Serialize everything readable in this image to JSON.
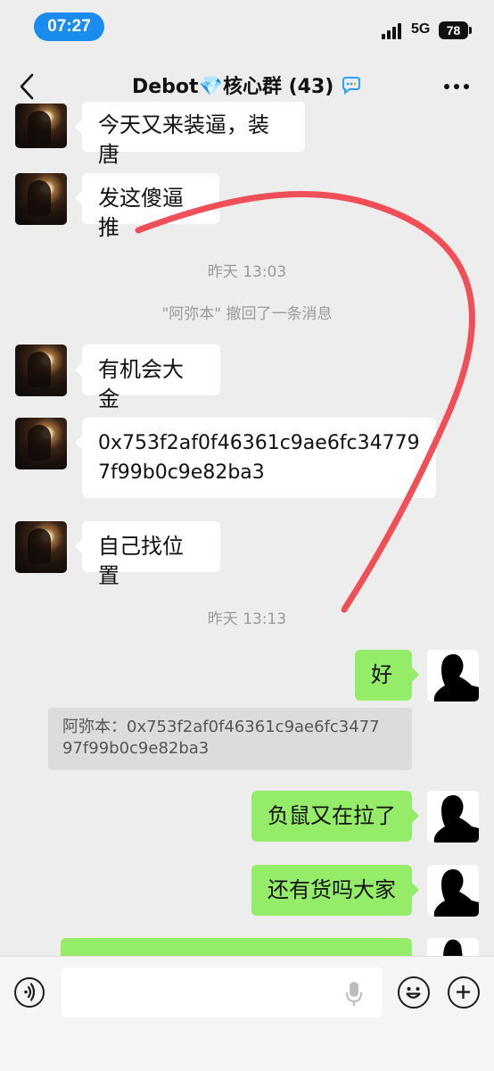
{
  "status_bar": {
    "time": "07:27",
    "network": "5G",
    "battery": "78"
  },
  "nav": {
    "title": "Debot",
    "title_gem": "💎",
    "title_rest": "核心群 (43)",
    "title_suffix_icon": "chat-bubble-icon"
  },
  "messages": {
    "m1": "今天又来装逼，装唐",
    "m2": "发这傻逼推",
    "ts1": "昨天 13:03",
    "recall": "\"阿弥本\" 撤回了一条消息",
    "m3": "有机会大金",
    "m4": "0x753f2af0f46361c9ae6fc34779\n7f99b0c9e82ba3",
    "m5": "自己找位置",
    "ts2": "昨天 13:13",
    "r1": "好",
    "quote": "阿弥本：0x753f2af0f46361c9ae6fc3477\n97f99b0c9e82ba3",
    "r2": "负鼠又在拉了",
    "r3": "还有货吗大家"
  },
  "colors": {
    "accent": "#1a8cf0",
    "sent_bubble": "#95ec69",
    "annotation": "#f04f58"
  }
}
